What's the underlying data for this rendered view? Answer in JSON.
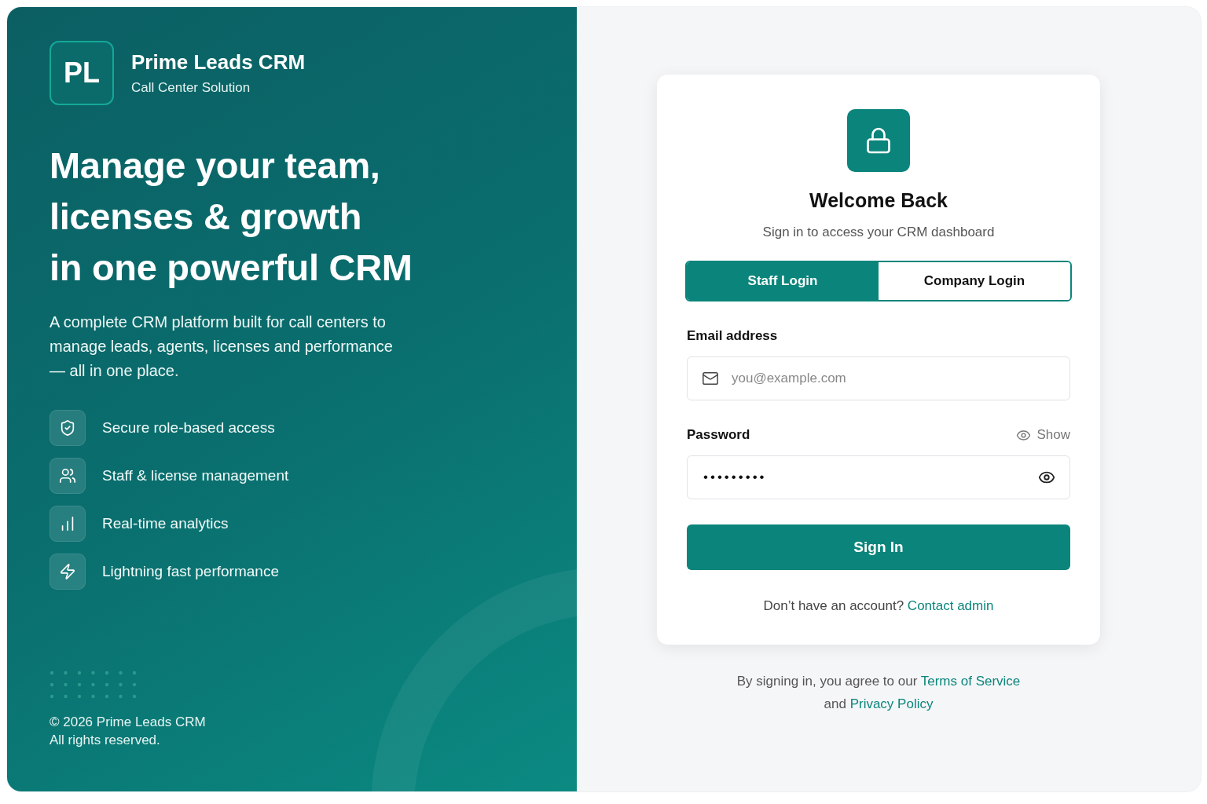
{
  "brand": {
    "logo": "PL",
    "name": "Prime Leads CRM",
    "tagline": "Call Center Solution"
  },
  "headline": [
    "Manage your team,",
    "licenses & growth",
    "in one powerful CRM"
  ],
  "description": "A complete CRM platform built for call centers to manage leads, agents, licenses and performance — all in one place.",
  "features": [
    {
      "kind": "shield",
      "label": "Secure role-based access"
    },
    {
      "kind": "users",
      "label": "Staff & license management"
    },
    {
      "kind": "analytics",
      "label": "Real-time analytics"
    },
    {
      "kind": "bolt",
      "label": "Lightning fast performance"
    }
  ],
  "copyright": [
    "© 2026 Prime Leads CRM",
    "All rights reserved."
  ],
  "card": {
    "title": "Welcome Back",
    "subtitle": "Sign in to access your CRM dashboard",
    "tabs": [
      {
        "label": "Staff Login",
        "selected": true
      },
      {
        "label": "Company Login",
        "selected": false
      }
    ],
    "email": {
      "label": "Email address",
      "placeholder": "you@example.com"
    },
    "password": {
      "label": "Password",
      "toggle": "Show",
      "value": "•••••••••"
    },
    "submit": "Sign In",
    "signup": {
      "text": "Don’t have an account?",
      "link": "Contact admin"
    }
  },
  "legal": {
    "before": "By signing in, you agree to our",
    "terms": "Terms of Service",
    "and": "and",
    "privacy": "Privacy Policy"
  }
}
